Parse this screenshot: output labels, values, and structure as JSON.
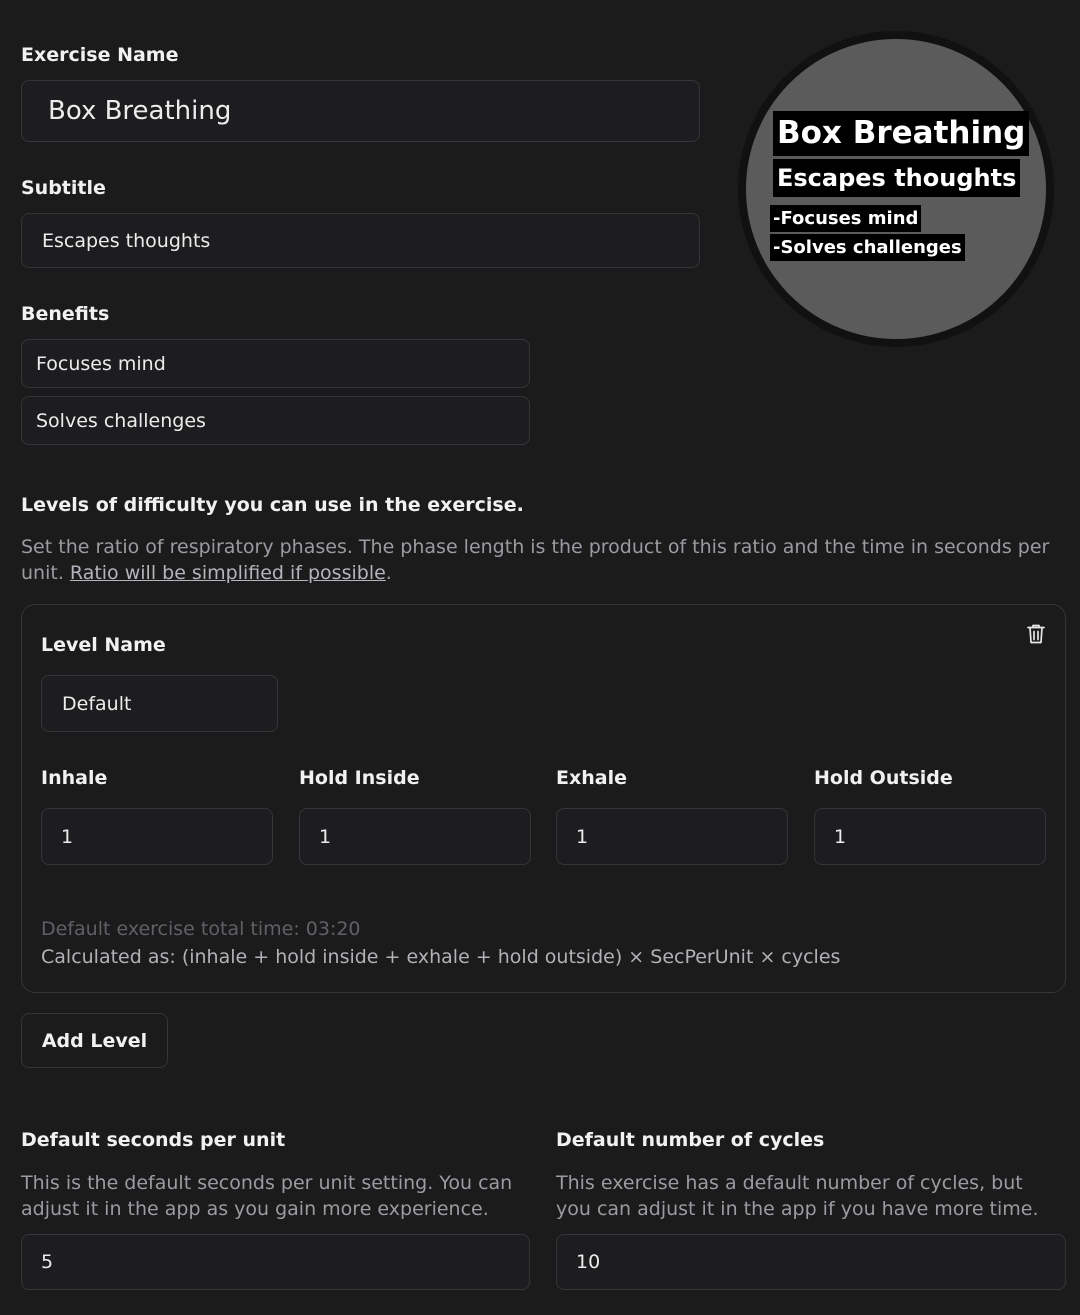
{
  "exercise": {
    "name_label": "Exercise Name",
    "name_value": "Box Breathing",
    "subtitle_label": "Subtitle",
    "subtitle_value": "Escapes thoughts",
    "benefits_label": "Benefits",
    "benefits": [
      "Focuses mind",
      "Solves challenges"
    ]
  },
  "preview": {
    "title": "Box Breathing",
    "subtitle": "Escapes thoughts",
    "benefit_1": "-Focuses mind",
    "benefit_2": "-Solves challenges"
  },
  "levels": {
    "heading": "Levels of difficulty you can use in the exercise.",
    "description": "Set the ratio of respiratory phases. The phase length is the product of this ratio and the time in seconds per unit.",
    "link_text": "Ratio will be simplified if possible",
    "link_suffix": ".",
    "level_name_label": "Level Name",
    "level_name_value": "Default",
    "phases": [
      {
        "label": "Inhale",
        "value": "1"
      },
      {
        "label": "Hold Inside",
        "value": "1"
      },
      {
        "label": "Exhale",
        "value": "1"
      },
      {
        "label": "Hold Outside",
        "value": "1"
      }
    ],
    "total_time": "Default exercise total time: 03:20",
    "formula": "Calculated as: (inhale + hold inside + exhale + hold outside) × SecPerUnit × cycles",
    "add_level": "Add Level"
  },
  "defaults": {
    "seconds_label": "Default seconds per unit",
    "seconds_desc": "This is the default seconds per unit setting. You can adjust it in the app as you gain more experience.",
    "seconds_value": "5",
    "cycles_label": "Default number of cycles",
    "cycles_desc": "This exercise has a default number of cycles, but you can adjust it in the app if you have more time.",
    "cycles_value": "10"
  },
  "colors": {
    "background": "#1b1b1c",
    "border": "#33353a",
    "preview_circle": "#5b5b5b"
  }
}
